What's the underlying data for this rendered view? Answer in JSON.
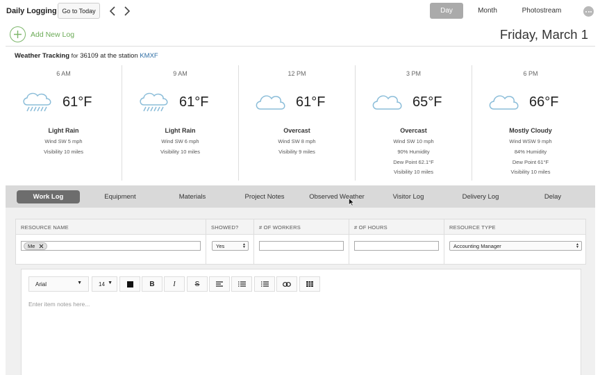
{
  "app": {
    "title": "Daily Logging"
  },
  "toolbar": {
    "today_label": "Go to Today",
    "views": [
      "Day",
      "Month",
      "Photostream"
    ],
    "active_view": "Day"
  },
  "header": {
    "add_label": "Add New Log",
    "date": "Friday, March 1"
  },
  "weather": {
    "label": "Weather Tracking",
    "for_text": "for",
    "zip": "36109",
    "station_text": "at the station",
    "station": "KMXF",
    "forecasts": [
      {
        "time": "6 AM",
        "temp": "61°F",
        "condition": "Light Rain",
        "icon": "rain-cloud-icon",
        "details": [
          "Wind SW 5 mph",
          "Visibility 10 miles"
        ]
      },
      {
        "time": "9 AM",
        "temp": "61°F",
        "condition": "Light Rain",
        "icon": "rain-cloud-icon",
        "details": [
          "Wind SW 6 mph",
          "Visibility 10 miles"
        ]
      },
      {
        "time": "12 PM",
        "temp": "61°F",
        "condition": "Overcast",
        "icon": "cloud-icon",
        "details": [
          "Wind SW 8 mph",
          "Visibility 9 miles"
        ]
      },
      {
        "time": "3 PM",
        "temp": "65°F",
        "condition": "Overcast",
        "icon": "cloud-icon",
        "details": [
          "Wind SW 10 mph",
          "90% Humidity",
          "Dew Point 62.1°F",
          "Visibility 10 miles"
        ]
      },
      {
        "time": "6 PM",
        "temp": "66°F",
        "condition": "Mostly Cloudy",
        "icon": "cloud-icon",
        "details": [
          "Wind WSW 9 mph",
          "84% Humidity",
          "Dew Point 61°F",
          "Visibility 10 miles"
        ]
      }
    ]
  },
  "tabs": [
    "Work Log",
    "Equipment",
    "Materials",
    "Project Notes",
    "Observed Weather",
    "Visitor Log",
    "Delivery Log",
    "Delay"
  ],
  "active_tab": "Work Log",
  "work_log": {
    "columns": [
      "RESOURCE NAME",
      "SHOWED?",
      "# OF WORKERS",
      "# OF HOURS",
      "RESOURCE TYPE"
    ],
    "resource_chip": "Me",
    "showed_value": "Yes",
    "workers_value": "",
    "hours_value": "",
    "resource_type_value": "Accounting Manager"
  },
  "editor": {
    "font": "Arial",
    "size": "14",
    "placeholder": "Enter item notes here..."
  },
  "colors": {
    "accent_green": "#6aaa55",
    "link_blue": "#2e6da4",
    "active_tab_bg": "#6d6d6d",
    "active_view_bg": "#aaaaaa"
  }
}
